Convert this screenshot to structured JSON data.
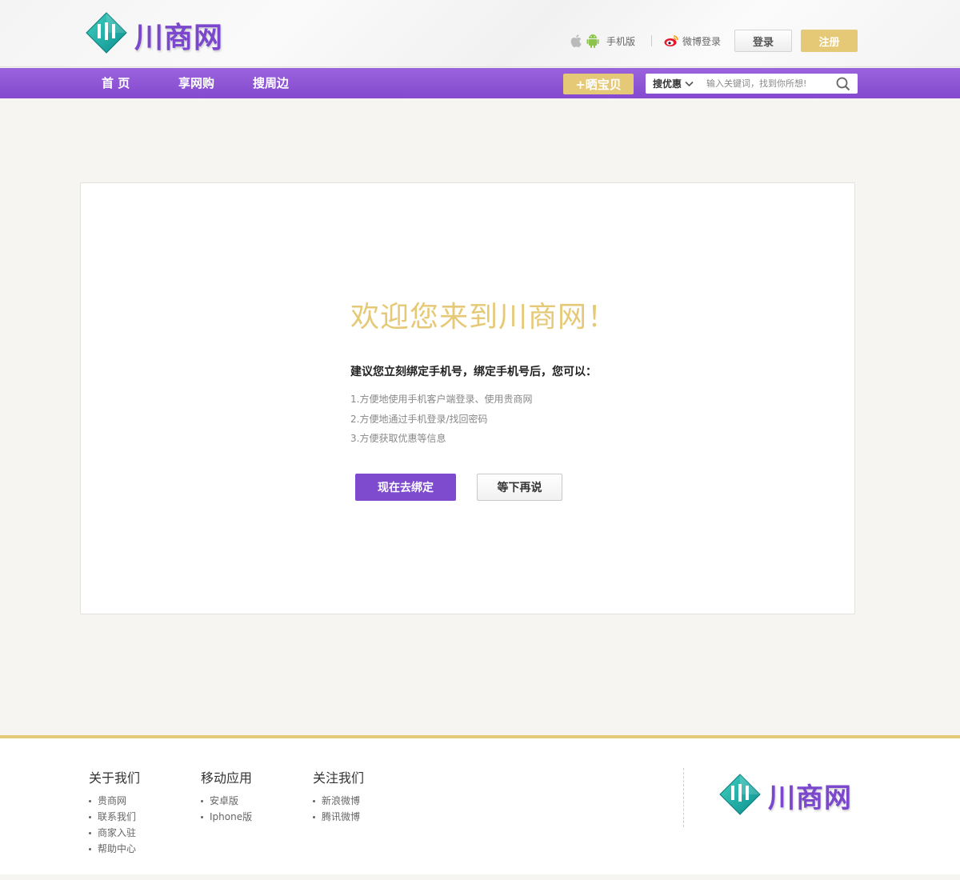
{
  "brand": {
    "name": "川商网",
    "accent": "#7e4bcf",
    "gold": "#e6c976"
  },
  "header": {
    "mobile_label": "手机版",
    "weibo_login_label": "微博登录",
    "login_label": "登录",
    "register_label": "注册"
  },
  "nav": {
    "items": [
      {
        "label": "首 页"
      },
      {
        "label": "享网购"
      },
      {
        "label": "搜周边"
      }
    ],
    "show_button_label": "+晒宝贝",
    "search": {
      "category": "搜优惠",
      "placeholder": "输入关键词，找到你所想!"
    }
  },
  "main": {
    "welcome": "欢迎您来到川商网！",
    "suggest": "建议您立刻绑定手机号，绑定手机号后，您可以：",
    "benefits": [
      "1.方便地使用手机客户端登录、使用贵商网",
      "2.方便地通过手机登录/找回密码",
      "3.方便获取优惠等信息"
    ],
    "bind_now_label": "现在去绑定",
    "later_label": "等下再说"
  },
  "footer": {
    "columns": [
      {
        "title": "关于我们",
        "links": [
          "贵商网",
          "联系我们",
          "商家入驻",
          "帮助中心"
        ]
      },
      {
        "title": "移动应用",
        "links": [
          "安卓版",
          "Iphone版"
        ]
      },
      {
        "title": "关注我们",
        "links": [
          "新浪微博",
          "腾讯微博"
        ]
      }
    ],
    "logo_text": "川商网"
  }
}
